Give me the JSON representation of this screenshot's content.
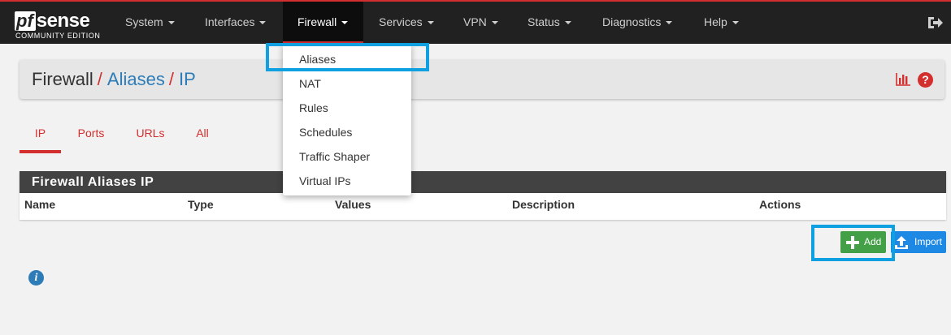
{
  "app": {
    "logo_main_pf": "pf",
    "logo_main_sense": "sense",
    "logo_sub": "COMMUNITY EDITION"
  },
  "nav": {
    "items": [
      {
        "label": "System"
      },
      {
        "label": "Interfaces"
      },
      {
        "label": "Firewall"
      },
      {
        "label": "Services"
      },
      {
        "label": "VPN"
      },
      {
        "label": "Status"
      },
      {
        "label": "Diagnostics"
      },
      {
        "label": "Help"
      }
    ],
    "active": "Firewall"
  },
  "firewall_menu": {
    "items": [
      "Aliases",
      "NAT",
      "Rules",
      "Schedules",
      "Traffic Shaper",
      "Virtual IPs"
    ]
  },
  "breadcrumb": {
    "root": "Firewall",
    "sep": "/",
    "level1": "Aliases",
    "level2": "IP"
  },
  "tabs": {
    "items": [
      "IP",
      "Ports",
      "URLs",
      "All"
    ],
    "active": "IP"
  },
  "panel": {
    "title": "Firewall Aliases IP",
    "columns": [
      "Name",
      "Type",
      "Values",
      "Description",
      "Actions"
    ]
  },
  "buttons": {
    "add": "Add",
    "import": "Import"
  },
  "colors": {
    "accent_red": "#d32f2f",
    "link_blue": "#2d7cb8",
    "add_green": "#43a047",
    "import_blue": "#1e88e5",
    "highlight": "#0ea0e0"
  },
  "icons": {
    "logout": "sign-out-icon",
    "chart": "bar-chart-icon",
    "help": "question-circle-icon",
    "info": "info-circle-icon",
    "add": "plus-icon",
    "import": "upload-icon"
  }
}
